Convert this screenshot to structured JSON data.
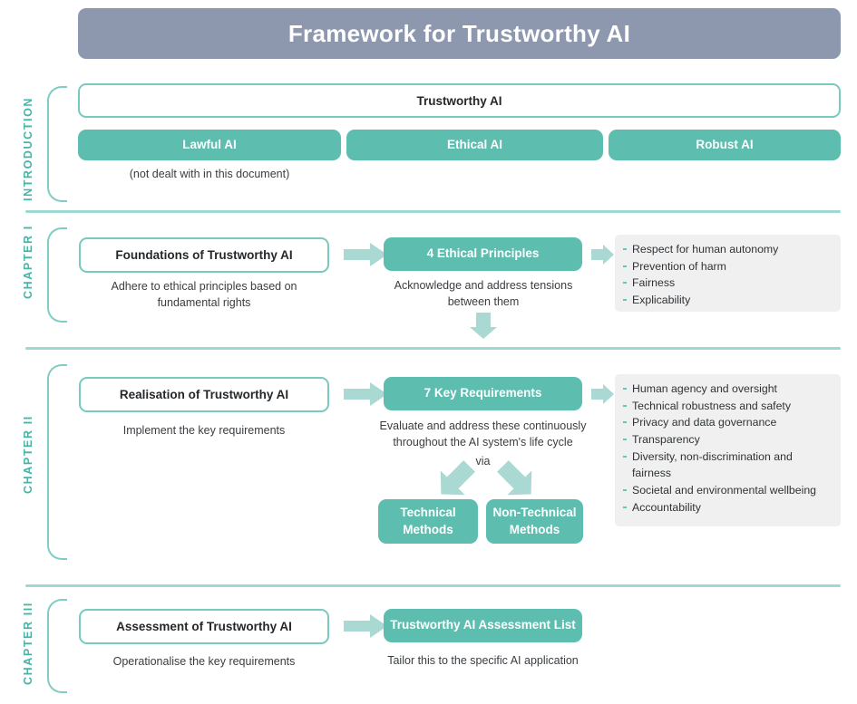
{
  "header": {
    "title": "Framework for Trustworthy AI"
  },
  "sections": {
    "introduction": {
      "rail_label": "INTRODUCTION",
      "main_box": "Trustworthy AI",
      "pillars": [
        {
          "label": "Lawful AI",
          "note": "(not dealt with in this document)"
        },
        {
          "label": "Ethical AI",
          "note": ""
        },
        {
          "label": "Robust AI",
          "note": ""
        }
      ]
    },
    "chapter_i": {
      "rail_label": "CHAPTER I",
      "left_box": "Foundations of Trustworthy AI",
      "left_caption": "Adhere to ethical principles based on fundamental rights",
      "center_box": "4 Ethical Principles",
      "center_caption": "Acknowledge and address tensions between them",
      "bullets": [
        "Respect for human autonomy",
        "Prevention of harm",
        "Fairness",
        "Explicability"
      ]
    },
    "chapter_ii": {
      "rail_label": "CHAPTER II",
      "left_box": "Realisation of Trustworthy AI",
      "left_caption": "Implement the key requirements",
      "center_box": "7 Key Requirements",
      "center_caption": "Evaluate and address these continuously throughout the AI system's life cycle",
      "via_label": "via",
      "method_boxes": [
        "Technical Methods",
        "Non-Technical Methods"
      ],
      "bullets": [
        "Human agency and oversight",
        "Technical robustness and safety",
        "Privacy and data governance",
        "Transparency",
        "Diversity, non-discrimination and fairness",
        "Societal and environmental wellbeing",
        "Accountability"
      ]
    },
    "chapter_iii": {
      "rail_label": "CHAPTER III",
      "left_box": "Assessment of Trustworthy AI",
      "left_caption": "Operationalise the key requirements",
      "center_box": "Trustworthy AI Assessment List",
      "center_caption": "Tailor this to the specific AI application"
    }
  },
  "colors": {
    "header_bg": "#8d98ae",
    "teal": "#5dbdaf",
    "teal_light": "#a9d9d2",
    "teal_rail": "#7fcdc3",
    "panel_bg": "#f0f0f0",
    "label_teal": "#49b3a6"
  }
}
